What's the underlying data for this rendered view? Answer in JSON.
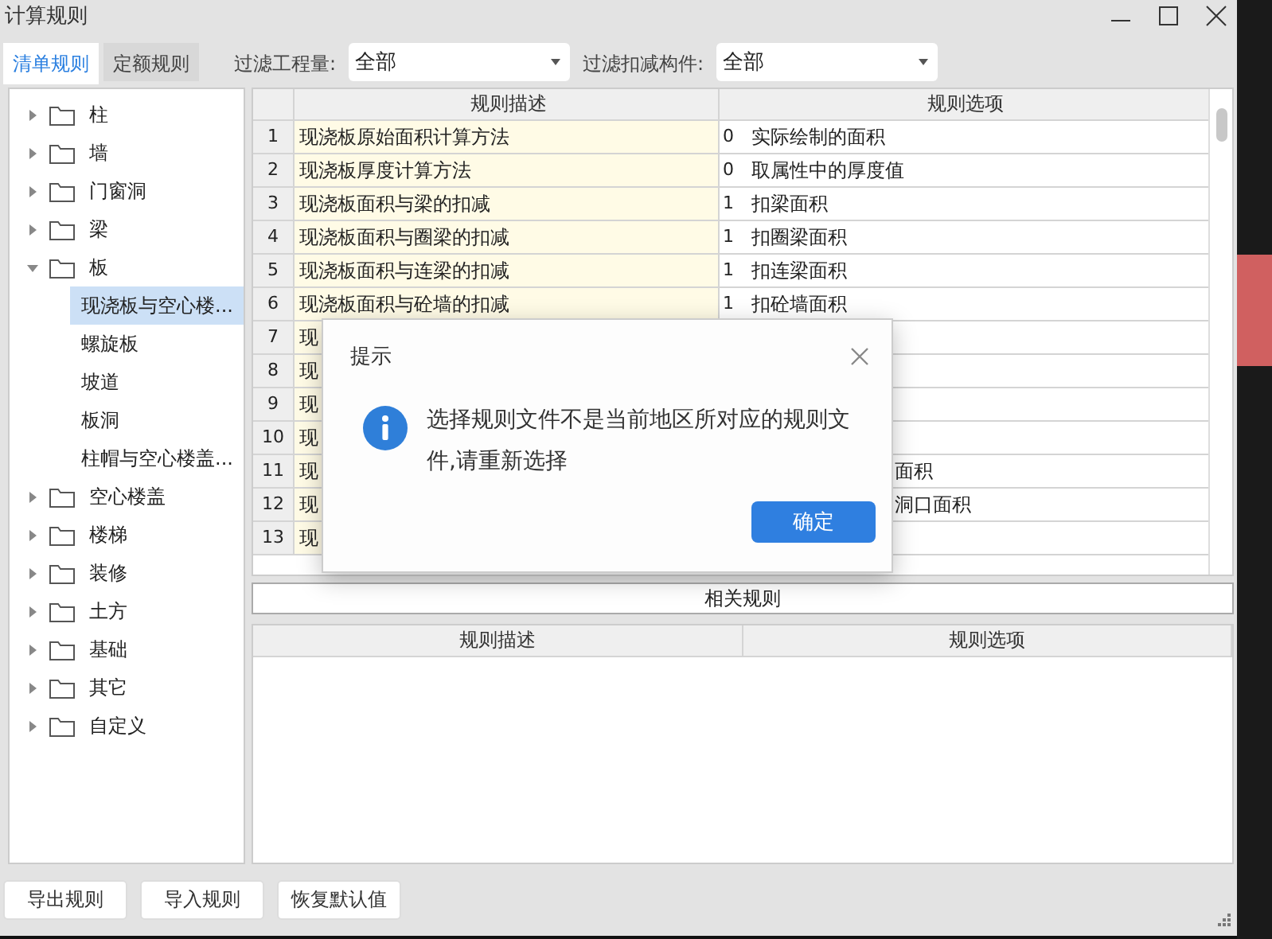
{
  "window": {
    "title": "计算规则"
  },
  "tabs": [
    {
      "label": "清单规则",
      "selected": true
    },
    {
      "label": "定额规则",
      "selected": false
    }
  ],
  "filters": [
    {
      "label": "过滤工程量:",
      "value": "全部"
    },
    {
      "label": "过滤扣减构件:",
      "value": "全部"
    }
  ],
  "tree": [
    {
      "label": "柱",
      "expanded": false
    },
    {
      "label": "墙",
      "expanded": false
    },
    {
      "label": "门窗洞",
      "expanded": false
    },
    {
      "label": "梁",
      "expanded": false
    },
    {
      "label": "板",
      "expanded": true,
      "children": [
        {
          "label": "现浇板与空心楼...",
          "selected": true
        },
        {
          "label": "螺旋板",
          "selected": false
        },
        {
          "label": "坡道",
          "selected": false
        },
        {
          "label": "板洞",
          "selected": false
        },
        {
          "label": "柱帽与空心楼盖...",
          "selected": false
        }
      ]
    },
    {
      "label": "空心楼盖",
      "expanded": false
    },
    {
      "label": "楼梯",
      "expanded": false
    },
    {
      "label": "装修",
      "expanded": false
    },
    {
      "label": "土方",
      "expanded": false
    },
    {
      "label": "基础",
      "expanded": false
    },
    {
      "label": "其它",
      "expanded": false
    },
    {
      "label": "自定义",
      "expanded": false
    }
  ],
  "rules_table": {
    "columns": [
      "规则描述",
      "规则选项"
    ],
    "rows": [
      {
        "kind": "full",
        "number": "1",
        "description": "现浇板原始面积计算方法",
        "option_code": "0",
        "option": "实际绘制的面积"
      },
      {
        "kind": "full",
        "number": "2",
        "description": "现浇板厚度计算方法",
        "option_code": "0",
        "option": "取属性中的厚度值"
      },
      {
        "kind": "full",
        "number": "3",
        "description": "现浇板面积与梁的扣减",
        "option_code": "1",
        "option": "扣梁面积"
      },
      {
        "kind": "full",
        "number": "4",
        "description": "现浇板面积与圈梁的扣减",
        "option_code": "1",
        "option": "扣圈梁面积"
      },
      {
        "kind": "full",
        "number": "5",
        "description": "现浇板面积与连梁的扣减",
        "option_code": "1",
        "option": "扣连梁面积"
      },
      {
        "kind": "full",
        "number": "6",
        "description": "现浇板面积与砼墙的扣减",
        "option_code": "1",
        "option": "扣砼墙面积"
      },
      {
        "kind": "covered",
        "number": "7",
        "description": "现"
      },
      {
        "kind": "covered",
        "number": "8",
        "description": "现"
      },
      {
        "kind": "covered",
        "number": "9",
        "description": "现"
      },
      {
        "kind": "covered",
        "number": "10",
        "description": "现"
      },
      {
        "kind": "covered",
        "number": "11",
        "description": "现",
        "option": "面积"
      },
      {
        "kind": "covered",
        "number": "12",
        "description": "现",
        "option": "洞口面积"
      },
      {
        "kind": "covered",
        "number": "13",
        "description": "现"
      }
    ]
  },
  "related": {
    "title": "相关规则",
    "columns": [
      "规则描述",
      "规则选项"
    ]
  },
  "buttons": [
    "导出规则",
    "导入规则",
    "恢复默认值"
  ],
  "dialog": {
    "title": "提示",
    "message": "选择规则文件不是当前地区所对应的规则文件,请重新选择",
    "button": "确定"
  }
}
